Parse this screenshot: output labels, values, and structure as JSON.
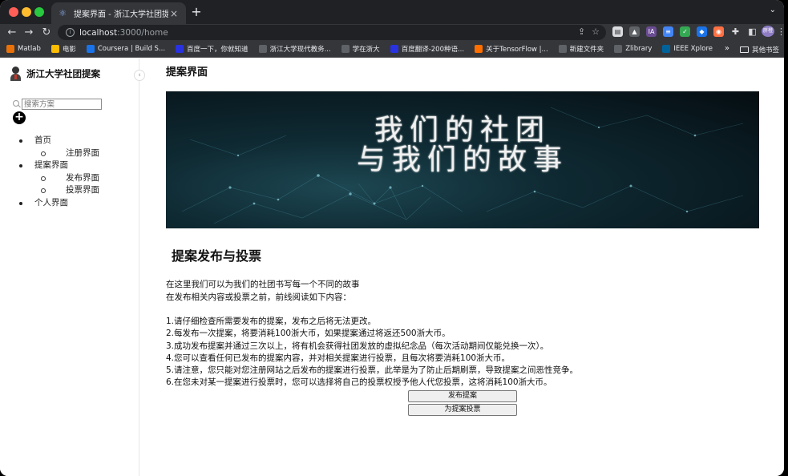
{
  "browser": {
    "tab_title": "提案界面 - 浙江大学社团提案",
    "new_tab": "+",
    "url_host": "localhost",
    "url_path": ":3000/home",
    "bookmarks": [
      {
        "label": "Matlab",
        "color": "#e8710a"
      },
      {
        "label": "电影",
        "color": "#fbbc04"
      },
      {
        "label": "Coursera | Build S...",
        "color": "#1a73e8"
      },
      {
        "label": "百度一下，你就知道",
        "color": "#2932e1"
      },
      {
        "label": "浙江大学现代教务...",
        "color": "#5f6368"
      },
      {
        "label": "学在浙大",
        "color": "#5f6368"
      },
      {
        "label": "百度翻译-200种语...",
        "color": "#2932e1"
      },
      {
        "label": "关于TensorFlow |...",
        "color": "#ff6f00"
      },
      {
        "label": "新建文件夹",
        "color": "#5f6368"
      },
      {
        "label": "Zlibrary",
        "color": "#5f6368"
      },
      {
        "label": "IEEE Xplore",
        "color": "#00629b"
      }
    ],
    "bookmarks_more": "»",
    "other_bookmarks": "其他书签",
    "extension_avatar": "胖橙"
  },
  "sidebar": {
    "brand": "浙江大学社团提案",
    "search_placeholder": "搜索方案",
    "add_symbol": "+",
    "collapse_symbol": "‹",
    "nav": [
      {
        "label": "首页",
        "level": 1
      },
      {
        "label": "注册界面",
        "level": 2
      },
      {
        "label": "提案界面",
        "level": 1
      },
      {
        "label": "发布界面",
        "level": 2
      },
      {
        "label": "投票界面",
        "level": 2
      },
      {
        "label": "个人界面",
        "level": 1
      }
    ]
  },
  "main": {
    "page_title": "提案界面",
    "banner_line1": "我们的社团",
    "banner_line2": "与我们的故事",
    "section_heading": "提案发布与投票",
    "intro_line1": "在这里我们可以为我们的社团书写每一个不同的故事",
    "intro_line2": "在发布相关内容或投票之前，前线阅读如下内容：",
    "rules": [
      "1.请仔细检查所需要发布的提案，发布之后将无法更改。",
      "2.每发布一次提案，将要消耗100浙大币，如果提案通过将返还500浙大币。",
      "3.成功发布提案并通过三次以上，将有机会获得社团发放的虚拟纪念品（每次活动期间仅能兑换一次）。",
      "4.您可以查看任何已发布的提案内容，并对相关提案进行投票，且每次将要消耗100浙大币。",
      "5.请注意，您只能对您注册网站之后发布的提案进行投票，此举是为了防止后期刷票，导致提案之间恶性竞争。",
      "6.在您未对某一提案进行投票时，您可以选择将自己的投票权授予他人代您投票，这将消耗100浙大币。"
    ],
    "publish_button": "发布提案",
    "vote_button": "为提案投票"
  }
}
